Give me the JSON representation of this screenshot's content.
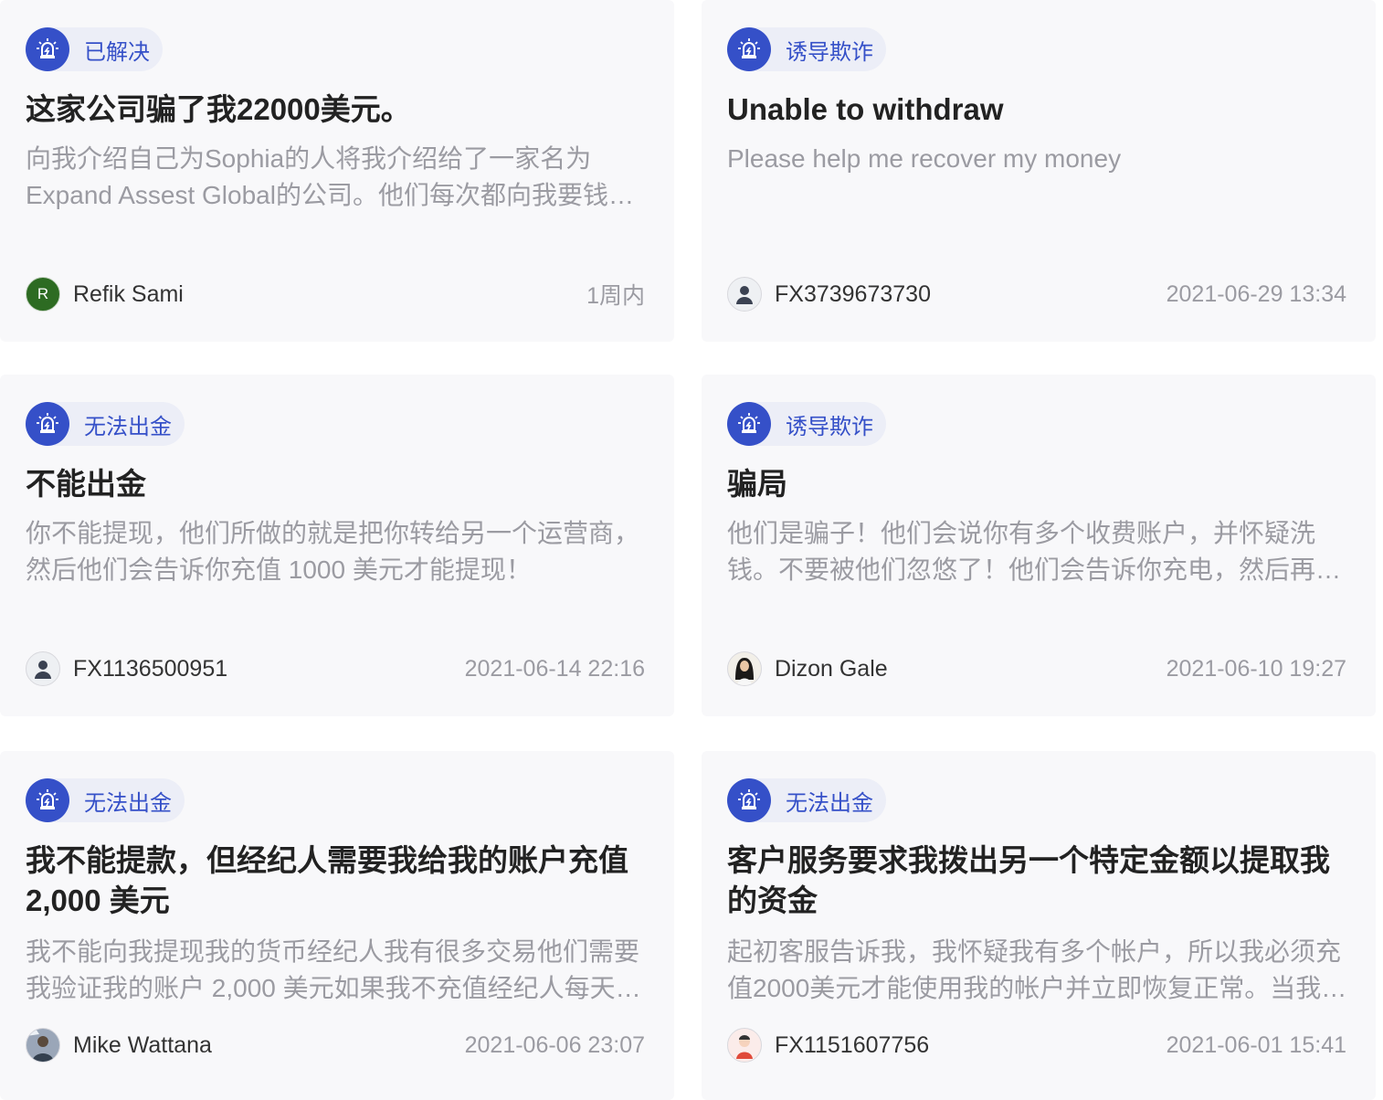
{
  "colors": {
    "accent": "#3550c8",
    "card_bg": "#f8f8fa",
    "tag_bg": "#eceef7"
  },
  "cards": [
    {
      "tag": "已解决",
      "title": "这家公司骗了我22000美元。",
      "description": "向我介绍自己为Sophia的人将我介绍给了一家名为Expand Assest Global的公司。他们每次都向我要钱…",
      "author": "Refik Sami",
      "avatar_letter": "R",
      "avatar_icon": "letter-avatar",
      "time": "1周内"
    },
    {
      "tag": "诱导欺诈",
      "title": "Unable to withdraw",
      "description": "Please help me recover my money",
      "author": "FX3739673730",
      "avatar_icon": "default-user-icon",
      "time": "2021-06-29 13:34"
    },
    {
      "tag": "无法出金",
      "title": "不能出金",
      "description": "你不能提现，他们所做的就是把你转给另一个运营商，然后他们会告诉你充值 1000 美元才能提现！",
      "author": "FX1136500951",
      "avatar_icon": "default-user-icon",
      "time": "2021-06-14 22:16"
    },
    {
      "tag": "诱导欺诈",
      "title": "骗局",
      "description": "他们是骗子！他们会说你有多个收费账户，并怀疑洗钱。不要被他们忽悠了！他们会告诉你充电，然后再…",
      "author": "Dizon Gale",
      "avatar_icon": "photo-avatar",
      "time": "2021-06-10 19:27"
    },
    {
      "tag": "无法出金",
      "title": "我不能提款，但经纪人需要我给我的账户充值 2,000 美元",
      "description": "我不能向我提现我的货币经纪人我有很多交易他们需要我验证我的账户 2,000 美元如果我不充值经纪人每天…",
      "author": "Mike Wattana",
      "avatar_icon": "photo-avatar",
      "time": "2021-06-06 23:07"
    },
    {
      "tag": "无法出金",
      "title": "客户服务要求我拨出另一个特定金额以提取我的资金",
      "description": "起初客服告诉我，我怀疑我有多个帐户，所以我必须充值2000美元才能使用我的帐户并立即恢复正常。当我…",
      "author": "FX1151607756",
      "avatar_icon": "cartoon-avatar",
      "time": "2021-06-01 15:41"
    }
  ]
}
